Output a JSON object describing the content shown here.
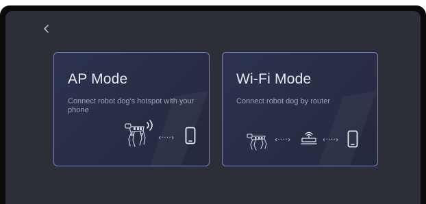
{
  "nav": {
    "back_icon": "chevron-left-icon"
  },
  "modes": {
    "ap": {
      "title": "AP Mode",
      "description": "Connect robot dog's hotspot with your phone",
      "icons": [
        "robot-dog-icon",
        "signal-waves-icon",
        "dots-arrow-icon",
        "phone-icon"
      ]
    },
    "wifi": {
      "title": "Wi-Fi Mode",
      "description": "Connect robot dog by router",
      "icons": [
        "robot-dog-icon",
        "dots-arrow-icon",
        "router-icon",
        "dots-arrow-icon",
        "phone-icon"
      ]
    }
  },
  "colors": {
    "background": "#2d2f38",
    "card_border": "#7b82b4",
    "title": "#e9eaf1",
    "description": "#9ea2b6"
  }
}
